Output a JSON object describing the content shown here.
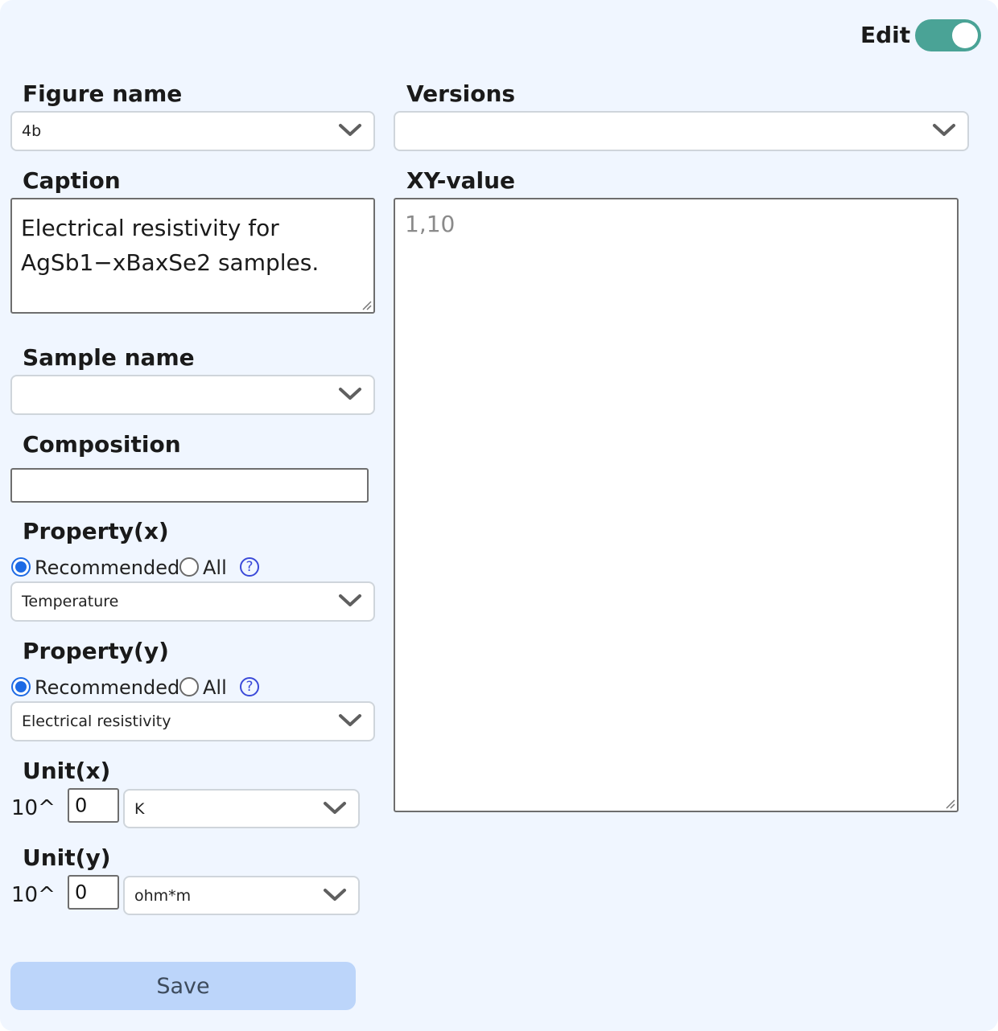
{
  "header": {
    "edit_label": "Edit",
    "edit_enabled": true
  },
  "figure_name": {
    "label": "Figure name",
    "value": "4b"
  },
  "versions": {
    "label": "Versions",
    "value": ""
  },
  "caption": {
    "label": "Caption",
    "value": "Electrical resistivity for AgSb1−xBaxSe2 samples."
  },
  "xy_value": {
    "label": "XY-value",
    "value": "1,10"
  },
  "sample_name": {
    "label": "Sample name",
    "value": ""
  },
  "composition": {
    "label": "Composition",
    "value": ""
  },
  "property_x": {
    "label": "Property(x)",
    "option_recommended": "Recommended",
    "option_all": "All",
    "selected_option": "Recommended",
    "help_glyph": "?",
    "value": "Temperature"
  },
  "property_y": {
    "label": "Property(y)",
    "option_recommended": "Recommended",
    "option_all": "All",
    "selected_option": "Recommended",
    "help_glyph": "?",
    "value": "Electrical resistivity"
  },
  "unit_x": {
    "label": "Unit(x)",
    "power_prefix": "10^",
    "exponent": "0",
    "unit": "K"
  },
  "unit_y": {
    "label": "Unit(y)",
    "power_prefix": "10^",
    "exponent": "0",
    "unit": "ohm*m"
  },
  "save_label": "Save",
  "colors": {
    "panel_bg": "#f0f6ff",
    "toggle_on": "#4aa396",
    "radio_selected": "#1d6ae5",
    "help_icon": "#3b4ad9",
    "save_button": "#bcd5fa"
  },
  "icons": {
    "dropdown": "chevron-down-icon",
    "help": "question-circle-icon",
    "resize": "resize-grip-icon"
  }
}
